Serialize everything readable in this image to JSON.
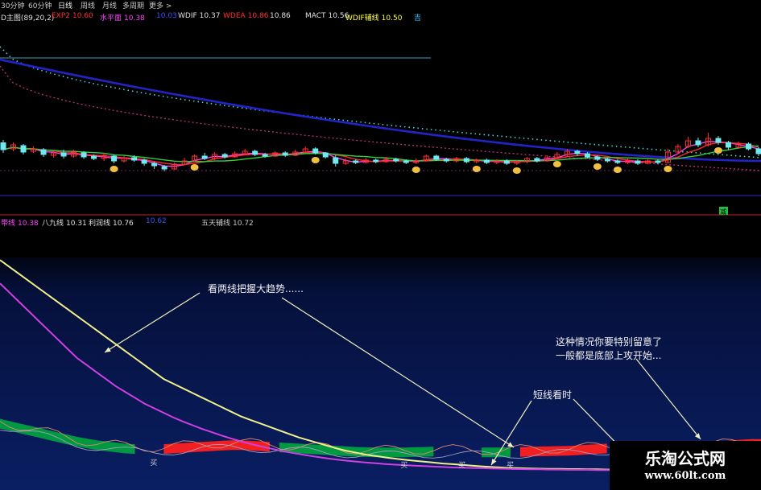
{
  "toolbar": {
    "tabs": [
      {
        "label": "30分钟",
        "active": false
      },
      {
        "label": "60分钟",
        "active": false
      },
      {
        "label": "日线",
        "active": true
      },
      {
        "label": "周线",
        "active": false
      },
      {
        "label": "月线",
        "active": false
      },
      {
        "label": "多周期",
        "active": false
      },
      {
        "label": "更多 >",
        "active": false
      }
    ]
  },
  "indicator_bar": {
    "title": "D主图(89,20,2)",
    "items": [
      {
        "label": "EXP2",
        "value": "10.60",
        "color": "#ff3030"
      },
      {
        "label": "水平面",
        "value": "10.38",
        "color": "#ff44ff"
      },
      {
        "label": "",
        "value": "10.03",
        "color": "#3355ff"
      },
      {
        "label": "WDIF",
        "value": "10.37",
        "color": "#e0e0e0"
      },
      {
        "label": "WDEA",
        "value": "10.86",
        "color": "#ff3030"
      },
      {
        "label": "",
        "value": "10.86",
        "color": "#e0e0e0"
      },
      {
        "label": "MACT",
        "value": "10.56",
        "color": "#e0e0e0"
      },
      {
        "label": "WDIF辅线",
        "value": "10.50",
        "color": "#ffff44"
      },
      {
        "label": "",
        "value": "吉",
        "color": "#33ccff"
      }
    ]
  },
  "ma_bar": {
    "items": [
      {
        "label": "带线",
        "value": "10.38",
        "color": "#ff44ff"
      },
      {
        "label": "八九线",
        "value": "10.31",
        "color": "#e0e0e0"
      },
      {
        "label": "利润线",
        "value": "10.76",
        "color": "#e0e0e0"
      },
      {
        "label": "",
        "value": "10.62",
        "color": "#3355ff"
      },
      {
        "label": "五天辅线",
        "value": "10.72",
        "color": "#c8c8c8"
      }
    ]
  },
  "annotations": {
    "trend": "看两线把握大趋势......",
    "note_line1": "这种情况你要特别留意了",
    "note_line2": "一般都是底部上攻开始...",
    "short": "短线看时",
    "buy_label": "买",
    "signal_label": "减"
  },
  "watermark": {
    "name": "乐淘公式网",
    "url": "www.60lt.com"
  },
  "colors": {
    "background_upper": "#000000",
    "background_lower": "#0a1e63",
    "candle_up": "#ff3030",
    "candle_down": "#70e8f0",
    "long_blue": "#2323c8",
    "cyan_dotted": "#3fd8d8",
    "magenta_dotted": "#c0307a",
    "yellow_trend": "#f0f08a",
    "purple_trend": "#d040e0",
    "green_ribbon": "#00a040",
    "red_ribbon": "#ff2020",
    "buy_marker": "#f0c040"
  },
  "chart_data": [
    {
      "type": "candlestick",
      "title": "D主图(89,20,2)",
      "note": "upper daily candlestick panel with moving-average overlays",
      "ylim": [
        9.6,
        11.4
      ],
      "candles": [
        {
          "o": 10.95,
          "c": 10.78,
          "h": 11.02,
          "l": 10.7
        },
        {
          "o": 10.8,
          "c": 10.9,
          "h": 10.96,
          "l": 10.74
        },
        {
          "o": 10.88,
          "c": 10.72,
          "h": 10.92,
          "l": 10.66
        },
        {
          "o": 10.74,
          "c": 10.8,
          "h": 10.86,
          "l": 10.7
        },
        {
          "o": 10.78,
          "c": 10.66,
          "h": 10.82,
          "l": 10.6
        },
        {
          "o": 10.64,
          "c": 10.7,
          "h": 10.76,
          "l": 10.58
        },
        {
          "o": 10.7,
          "c": 10.62,
          "h": 10.78,
          "l": 10.56
        },
        {
          "o": 10.62,
          "c": 10.72,
          "h": 10.78,
          "l": 10.58
        },
        {
          "o": 10.7,
          "c": 10.6,
          "h": 10.74,
          "l": 10.55
        },
        {
          "o": 10.62,
          "c": 10.56,
          "h": 10.66,
          "l": 10.52
        },
        {
          "o": 10.56,
          "c": 10.64,
          "h": 10.7,
          "l": 10.5
        },
        {
          "o": 10.62,
          "c": 10.5,
          "h": 10.66,
          "l": 10.44
        },
        {
          "o": 10.5,
          "c": 10.58,
          "h": 10.62,
          "l": 10.46
        },
        {
          "o": 10.58,
          "c": 10.52,
          "h": 10.64,
          "l": 10.48
        },
        {
          "o": 10.52,
          "c": 10.44,
          "h": 10.56,
          "l": 10.38
        },
        {
          "o": 10.44,
          "c": 10.38,
          "h": 10.48,
          "l": 10.3
        },
        {
          "o": 10.36,
          "c": 10.3,
          "h": 10.4,
          "l": 10.24
        },
        {
          "o": 10.3,
          "c": 10.42,
          "h": 10.46,
          "l": 10.28
        },
        {
          "o": 10.42,
          "c": 10.5,
          "h": 10.58,
          "l": 10.4
        },
        {
          "o": 10.5,
          "c": 10.62,
          "h": 10.66,
          "l": 10.48
        },
        {
          "o": 10.62,
          "c": 10.56,
          "h": 10.7,
          "l": 10.52
        },
        {
          "o": 10.56,
          "c": 10.66,
          "h": 10.72,
          "l": 10.52
        },
        {
          "o": 10.66,
          "c": 10.6,
          "h": 10.7,
          "l": 10.56
        },
        {
          "o": 10.6,
          "c": 10.68,
          "h": 10.74,
          "l": 10.58
        },
        {
          "o": 10.68,
          "c": 10.74,
          "h": 10.8,
          "l": 10.64
        },
        {
          "o": 10.74,
          "c": 10.66,
          "h": 10.78,
          "l": 10.62
        },
        {
          "o": 10.66,
          "c": 10.62,
          "h": 10.7,
          "l": 10.58
        },
        {
          "o": 10.62,
          "c": 10.7,
          "h": 10.74,
          "l": 10.6
        },
        {
          "o": 10.7,
          "c": 10.64,
          "h": 10.74,
          "l": 10.6
        },
        {
          "o": 10.64,
          "c": 10.72,
          "h": 10.78,
          "l": 10.62
        },
        {
          "o": 10.72,
          "c": 10.8,
          "h": 10.86,
          "l": 10.7
        },
        {
          "o": 10.8,
          "c": 10.7,
          "h": 10.84,
          "l": 10.66
        },
        {
          "o": 10.7,
          "c": 10.6,
          "h": 10.72,
          "l": 10.56
        },
        {
          "o": 10.58,
          "c": 10.44,
          "h": 10.64,
          "l": 10.36
        },
        {
          "o": 10.44,
          "c": 10.5,
          "h": 10.56,
          "l": 10.4
        },
        {
          "o": 10.5,
          "c": 10.46,
          "h": 10.54,
          "l": 10.42
        },
        {
          "o": 10.46,
          "c": 10.52,
          "h": 10.58,
          "l": 10.44
        },
        {
          "o": 10.52,
          "c": 10.48,
          "h": 10.56,
          "l": 10.44
        },
        {
          "o": 10.48,
          "c": 10.54,
          "h": 10.6,
          "l": 10.46
        },
        {
          "o": 10.54,
          "c": 10.5,
          "h": 10.58,
          "l": 10.46
        },
        {
          "o": 10.5,
          "c": 10.46,
          "h": 10.54,
          "l": 10.42
        },
        {
          "o": 10.46,
          "c": 10.5,
          "h": 10.56,
          "l": 10.42
        },
        {
          "o": 10.5,
          "c": 10.62,
          "h": 10.66,
          "l": 10.48
        },
        {
          "o": 10.62,
          "c": 10.54,
          "h": 10.66,
          "l": 10.5
        },
        {
          "o": 10.54,
          "c": 10.5,
          "h": 10.58,
          "l": 10.46
        },
        {
          "o": 10.5,
          "c": 10.56,
          "h": 10.6,
          "l": 10.46
        },
        {
          "o": 10.56,
          "c": 10.48,
          "h": 10.6,
          "l": 10.44
        },
        {
          "o": 10.48,
          "c": 10.52,
          "h": 10.56,
          "l": 10.44
        },
        {
          "o": 10.52,
          "c": 10.46,
          "h": 10.56,
          "l": 10.42
        },
        {
          "o": 10.46,
          "c": 10.5,
          "h": 10.54,
          "l": 10.42
        },
        {
          "o": 10.5,
          "c": 10.44,
          "h": 10.54,
          "l": 10.4
        },
        {
          "o": 10.44,
          "c": 10.48,
          "h": 10.52,
          "l": 10.4
        },
        {
          "o": 10.48,
          "c": 10.56,
          "h": 10.6,
          "l": 10.44
        },
        {
          "o": 10.56,
          "c": 10.5,
          "h": 10.6,
          "l": 10.46
        },
        {
          "o": 10.5,
          "c": 10.58,
          "h": 10.64,
          "l": 10.48
        },
        {
          "o": 10.58,
          "c": 10.66,
          "h": 10.72,
          "l": 10.56
        },
        {
          "o": 10.66,
          "c": 10.74,
          "h": 10.8,
          "l": 10.62
        },
        {
          "o": 10.74,
          "c": 10.68,
          "h": 10.78,
          "l": 10.62
        },
        {
          "o": 10.68,
          "c": 10.6,
          "h": 10.72,
          "l": 10.56
        },
        {
          "o": 10.6,
          "c": 10.54,
          "h": 10.64,
          "l": 10.5
        },
        {
          "o": 10.54,
          "c": 10.5,
          "h": 10.58,
          "l": 10.46
        },
        {
          "o": 10.5,
          "c": 10.46,
          "h": 10.54,
          "l": 10.42
        },
        {
          "o": 10.46,
          "c": 10.5,
          "h": 10.56,
          "l": 10.42
        },
        {
          "o": 10.5,
          "c": 10.44,
          "h": 10.54,
          "l": 10.4
        },
        {
          "o": 10.44,
          "c": 10.5,
          "h": 10.54,
          "l": 10.42
        },
        {
          "o": 10.5,
          "c": 10.46,
          "h": 10.54,
          "l": 10.42
        },
        {
          "o": 10.46,
          "c": 10.72,
          "h": 10.8,
          "l": 10.44
        },
        {
          "o": 10.72,
          "c": 10.86,
          "h": 10.92,
          "l": 10.68
        },
        {
          "o": 10.86,
          "c": 11.0,
          "h": 11.1,
          "l": 10.82
        },
        {
          "o": 11.0,
          "c": 10.9,
          "h": 11.08,
          "l": 10.84
        },
        {
          "o": 10.9,
          "c": 11.06,
          "h": 11.2,
          "l": 10.86
        },
        {
          "o": 11.06,
          "c": 10.96,
          "h": 11.12,
          "l": 10.9
        },
        {
          "o": 10.96,
          "c": 10.84,
          "h": 11.0,
          "l": 10.78
        },
        {
          "o": 10.84,
          "c": 10.92,
          "h": 10.98,
          "l": 10.8
        },
        {
          "o": 10.92,
          "c": 10.8,
          "h": 10.96,
          "l": 10.76
        },
        {
          "o": 10.8,
          "c": 10.68,
          "h": 10.84,
          "l": 10.62
        }
      ],
      "buy_marker_indices": [
        11,
        19,
        31,
        41,
        47,
        51,
        55,
        59,
        61,
        66,
        71
      ]
    },
    {
      "type": "line",
      "title": "",
      "note": "lower indicator panel: two long trend lines over a ribbon band",
      "x_count": 80,
      "series": [
        {
          "name": "",
          "color": "#f0f08a",
          "values": [
            92,
            89,
            86,
            83,
            80,
            77,
            74,
            71,
            68,
            65,
            62,
            59,
            56,
            53,
            50,
            47,
            44,
            41,
            39,
            37,
            35,
            33,
            31,
            29,
            27,
            25,
            23.5,
            22,
            20.5,
            19,
            17.5,
            16,
            14.8,
            13.6,
            12.4,
            11.2,
            10.2,
            9.4,
            8.6,
            8,
            7.4,
            6.9,
            6.4,
            6,
            5.6,
            5.2,
            4.8,
            4.5,
            4.2,
            3.9,
            3.6,
            3.3,
            3.1,
            2.9,
            2.8,
            2.7,
            2.6,
            2.5,
            2.5,
            2.4,
            2.4,
            2.3,
            2.3,
            2.2,
            2.2,
            2.2,
            2.1,
            2.1,
            2.1,
            2.1,
            2.0,
            2.0,
            2.0,
            2.0,
            2.0,
            2.0,
            2.0,
            2.0,
            2.0,
            2.0
          ]
        },
        {
          "name": "",
          "color": "#d040e0",
          "values": [
            82,
            78,
            74,
            70,
            66,
            62,
            58,
            54,
            50,
            47,
            44,
            41,
            38,
            35.5,
            33,
            30.5,
            28.5,
            26.5,
            24.5,
            22.8,
            21.2,
            19.6,
            18.2,
            16.8,
            15.5,
            14.3,
            13.2,
            12.2,
            11.3,
            10.4,
            9.6,
            8.9,
            8.2,
            7.6,
            7,
            6.5,
            6,
            5.6,
            5.2,
            4.9,
            4.6,
            4.3,
            4.1,
            3.9,
            3.7,
            3.5,
            3.3,
            3.1,
            3,
            2.9,
            2.8,
            2.7,
            2.6,
            2.5,
            2.4,
            2.3,
            2.3,
            2.2,
            2.2,
            2.1,
            2.1,
            2.1,
            2.0,
            2.0,
            2.0,
            2.0,
            2.0,
            2.0,
            2.0,
            2.0,
            2.0,
            2.0,
            2.0,
            2.0,
            2.0,
            2.0,
            2.0,
            2.0,
            2.0,
            2.0
          ]
        },
        {
          "name": "",
          "color": "#ff2020",
          "values": [
            26,
            24,
            22,
            20,
            18,
            16,
            14,
            12,
            10,
            8.5,
            7,
            6,
            5,
            4,
            3.5,
            3,
            3,
            3.5,
            4,
            4.5,
            5,
            5.5,
            6,
            6.5,
            7,
            7,
            6.5,
            6,
            5.5,
            5,
            4.5,
            4,
            3.5,
            3,
            2.5,
            2,
            1.5,
            1,
            0.8,
            0.6,
            0.5,
            0.5,
            0.6,
            0.8,
            1,
            1.2,
            1.2,
            1,
            0.8,
            0.6,
            0.5,
            0.5,
            0.6,
            0.8,
            1,
            1.2,
            1.4,
            1.6,
            1.8,
            2,
            2.4,
            3,
            3.5,
            4,
            4.2,
            4.2,
            4,
            3.8,
            3.5,
            3.2,
            3,
            3,
            3.5,
            4,
            5,
            6,
            7,
            7.5,
            8,
            8
          ]
        }
      ],
      "ylim": [
        0,
        100
      ],
      "buy_marker_indices": [
        16,
        42,
        48,
        53
      ]
    }
  ]
}
